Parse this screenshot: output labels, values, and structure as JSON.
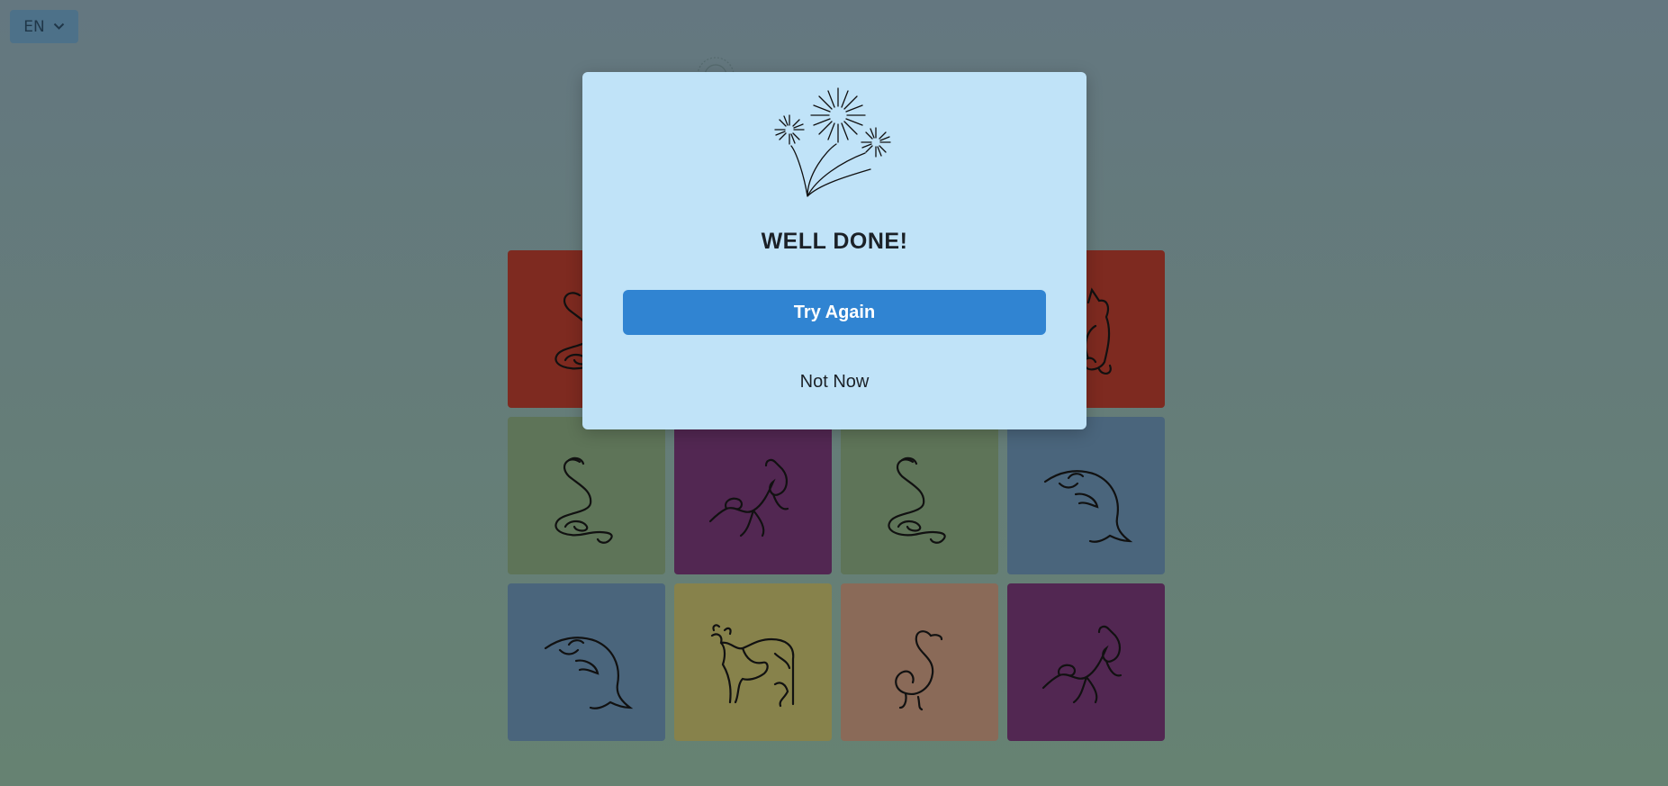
{
  "language_selector": {
    "value": "EN",
    "icon": "chevron-down-icon"
  },
  "dialog": {
    "icon": "fireworks-icon",
    "title": "WELL DONE!",
    "primary_button": "Try Again",
    "secondary_button": "Not Now"
  },
  "cards": [
    {
      "animal": "snake",
      "color": "#7e2a20"
    },
    {
      "animal": "hidden",
      "color": ""
    },
    {
      "animal": "hidden",
      "color": ""
    },
    {
      "animal": "cat",
      "color": "#7e2a20"
    },
    {
      "animal": "snake",
      "color": "#5e7458"
    },
    {
      "animal": "horse",
      "color": "#522752"
    },
    {
      "animal": "snake",
      "color": "#5e7458"
    },
    {
      "animal": "dolphin",
      "color": "#4a657c"
    },
    {
      "animal": "dolphin",
      "color": "#4a657c"
    },
    {
      "animal": "cow",
      "color": "#87824b"
    },
    {
      "animal": "swan",
      "color": "#8a6a58"
    },
    {
      "animal": "horse",
      "color": "#522752"
    }
  ],
  "colors": {
    "overlay_top": "#647780",
    "overlay_bottom": "#668272",
    "dialog_bg": "#c0e3f8",
    "primary": "#3084d2"
  }
}
